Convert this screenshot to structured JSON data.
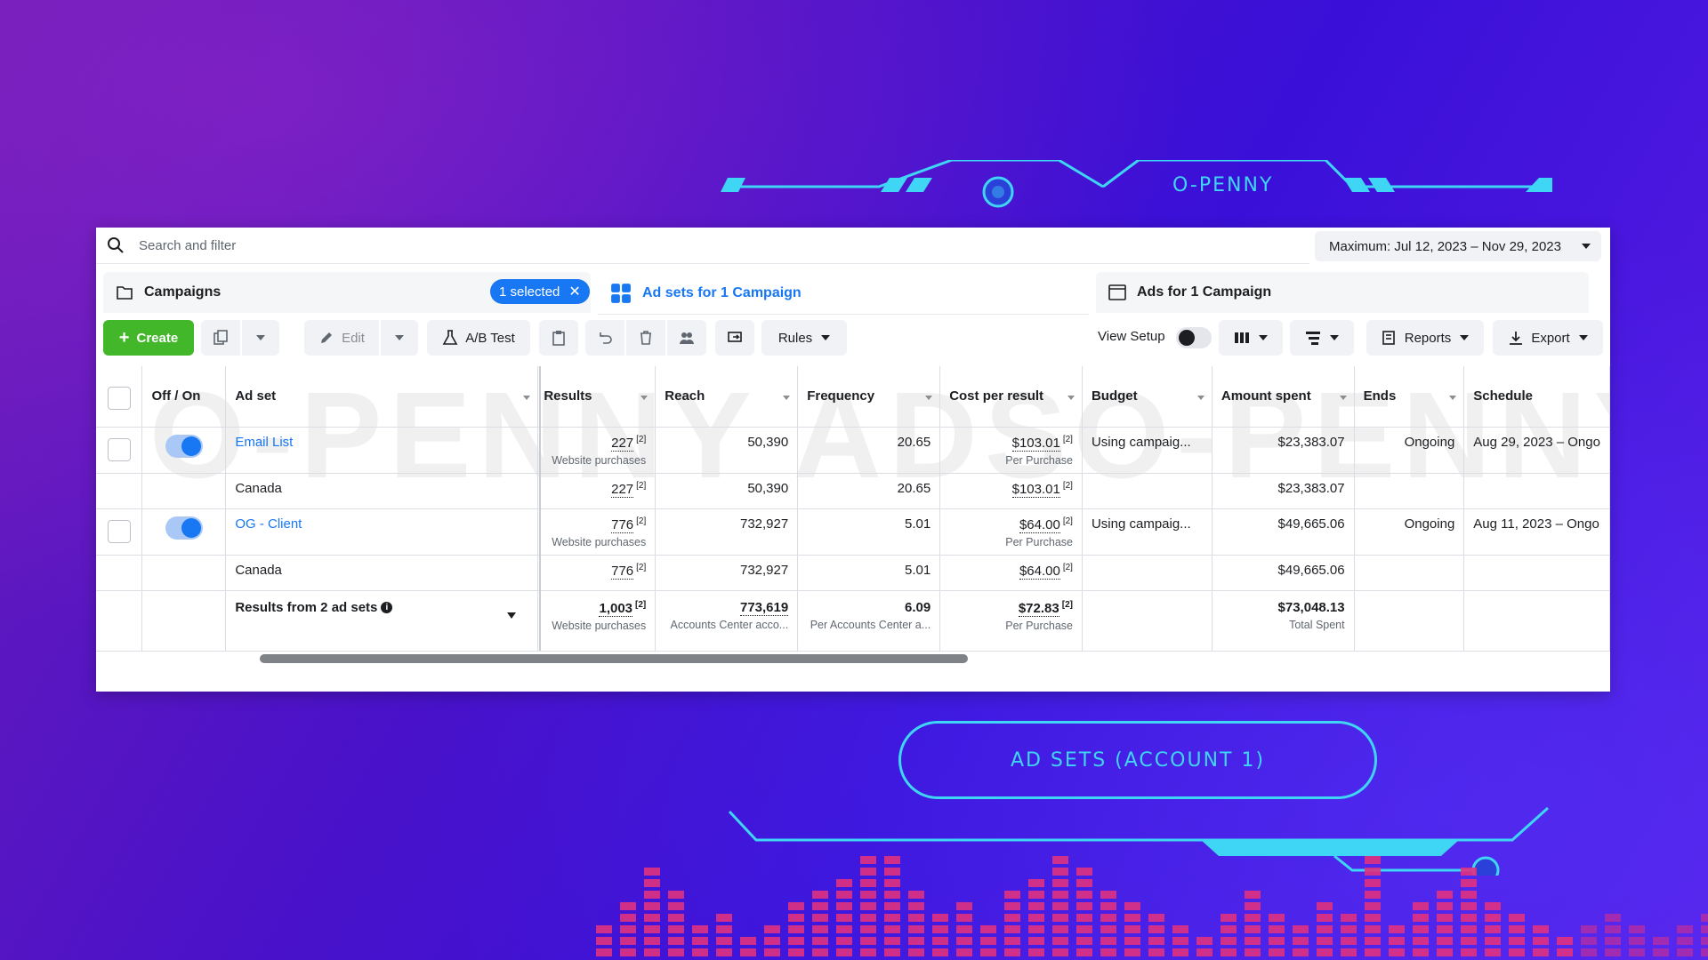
{
  "brand": {
    "name": "O-PENNY"
  },
  "watermark": "O-PENNY ADSO-PENNY ADS",
  "search": {
    "placeholder": "Search and filter"
  },
  "date_range": {
    "label": "Maximum: Jul 12, 2023 – Nov 29, 2023"
  },
  "tabs": [
    {
      "label": "Campaigns",
      "icon": "folder-icon",
      "selected": "1 selected"
    },
    {
      "label": "Ad sets for 1 Campaign",
      "icon": "grid-icon"
    },
    {
      "label": "Ads for 1 Campaign",
      "icon": "ad-icon"
    }
  ],
  "toolbar": {
    "create": "Create",
    "edit": "Edit",
    "ab_test": "A/B Test",
    "rules": "Rules",
    "view_setup": "View Setup",
    "reports": "Reports",
    "export": "Export"
  },
  "columns": [
    "Off / On",
    "Ad set",
    "Results",
    "Reach",
    "Frequency",
    "Cost per result",
    "Budget",
    "Amount spent",
    "Ends",
    "Schedule"
  ],
  "rows": [
    {
      "name": "Email List",
      "results": "227",
      "results_sub": "Website purchases",
      "reach": "50,390",
      "frequency": "20.65",
      "cpr": "$103.01",
      "cpr_sub": "Per Purchase",
      "budget": "Using campaig...",
      "spent": "$23,383.07",
      "ends": "Ongoing",
      "schedule": "Aug 29, 2023 – Ongo",
      "breakdown": {
        "name": "Canada",
        "results": "227",
        "reach": "50,390",
        "frequency": "20.65",
        "cpr": "$103.01",
        "spent": "$23,383.07"
      }
    },
    {
      "name": "OG - Client",
      "results": "776",
      "results_sub": "Website purchases",
      "reach": "732,927",
      "frequency": "5.01",
      "cpr": "$64.00",
      "cpr_sub": "Per Purchase",
      "budget": "Using campaig...",
      "spent": "$49,665.06",
      "ends": "Ongoing",
      "schedule": "Aug 11, 2023 – Ongo",
      "breakdown": {
        "name": "Canada",
        "results": "776",
        "reach": "732,927",
        "frequency": "5.01",
        "cpr": "$64.00",
        "spent": "$49,665.06"
      }
    }
  ],
  "totals": {
    "label": "Results from 2 ad sets",
    "results": "1,003",
    "results_sub": "Website purchases",
    "reach": "773,619",
    "reach_sub": "Accounts Center acco...",
    "frequency": "6.09",
    "frequency_sub": "Per Accounts Center a...",
    "cpr": "$72.83",
    "cpr_sub": "Per Purchase",
    "spent": "$73,048.13",
    "spent_sub": "Total Spent"
  },
  "footnote_marker": "[2]",
  "cta": {
    "label": "AD SETS (ACCOUNT 1)"
  },
  "colors": {
    "accent": "#1877f2",
    "create_green": "#42b72a",
    "hud_cyan": "#3fd6f5",
    "eq_pink": "#e0327f"
  }
}
